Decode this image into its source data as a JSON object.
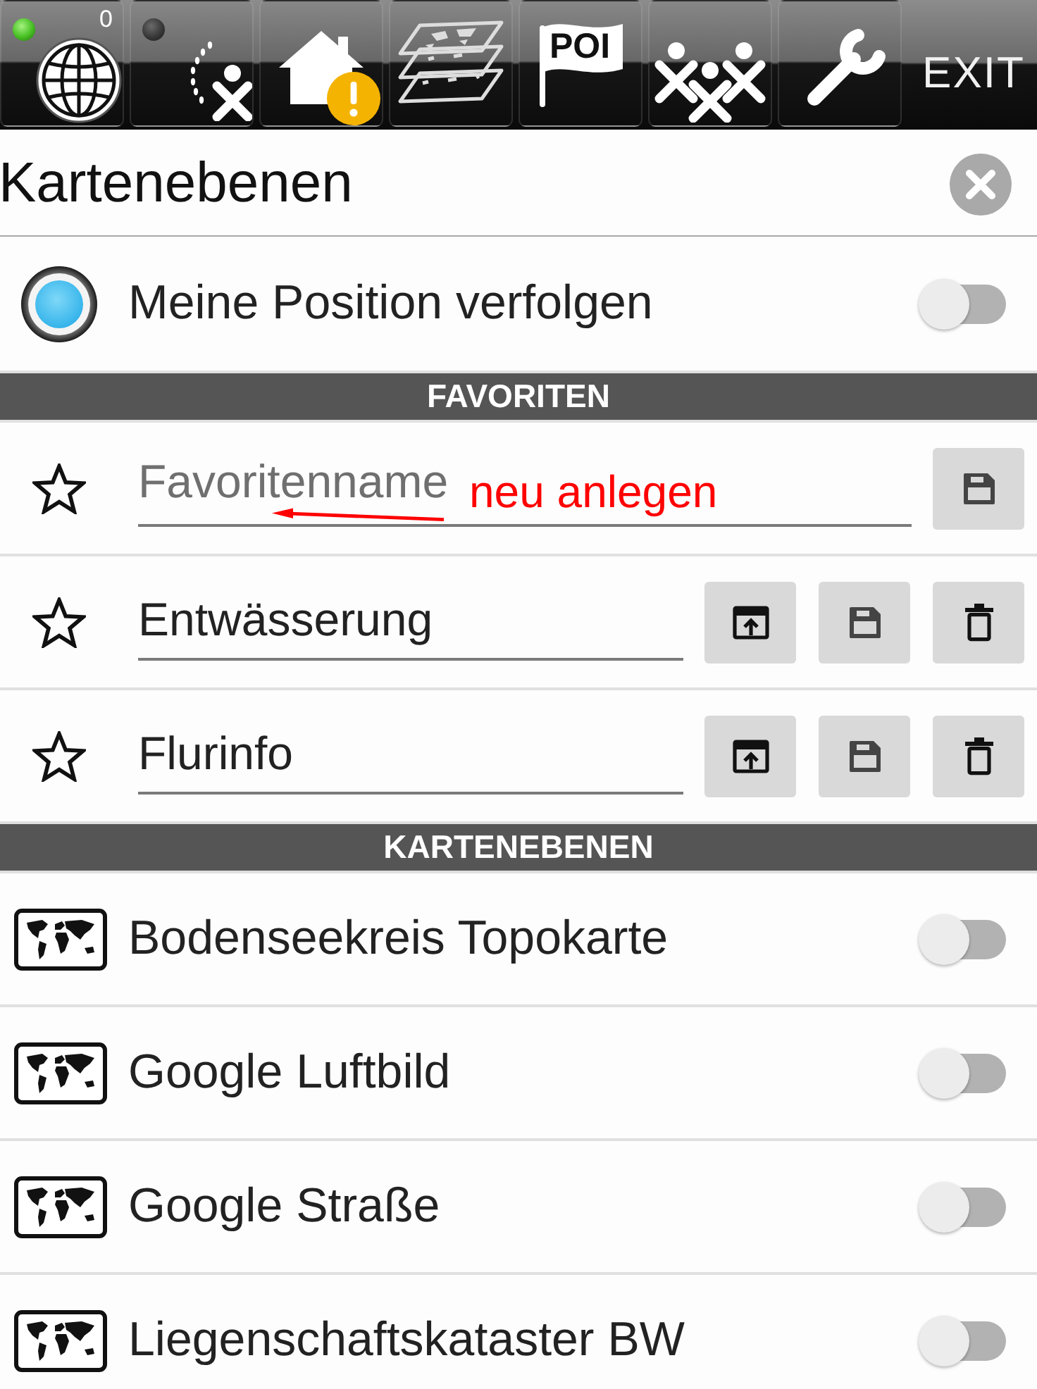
{
  "toolbar": {
    "buttons": [
      {
        "kind": "globe",
        "lit": true,
        "count": "0"
      },
      {
        "kind": "track",
        "lit": false
      },
      {
        "kind": "home",
        "warning": true
      },
      {
        "kind": "layers"
      },
      {
        "kind": "poi",
        "label": "POI"
      },
      {
        "kind": "group"
      },
      {
        "kind": "settings"
      },
      {
        "kind": "exit",
        "label": "EXIT"
      }
    ]
  },
  "dialog": {
    "title": "Kartenebenen"
  },
  "track_position": {
    "label": "Meine Position verfolgen",
    "on": false
  },
  "favorites": {
    "title": "FAVORITEN",
    "new_entry": {
      "placeholder": "Favoritenname"
    },
    "items": [
      {
        "name": "Entwässerung"
      },
      {
        "name": "Flurinfo"
      }
    ]
  },
  "annotation": {
    "text": "neu anlegen"
  },
  "layers": {
    "title": "KARTENEBENEN",
    "items": [
      {
        "name": "Bodenseekreis Topokarte",
        "on": false
      },
      {
        "name": "Google Luftbild",
        "on": false
      },
      {
        "name": "Google Straße",
        "on": false
      },
      {
        "name": "Liegenschaftskataster BW",
        "on": false
      }
    ]
  }
}
